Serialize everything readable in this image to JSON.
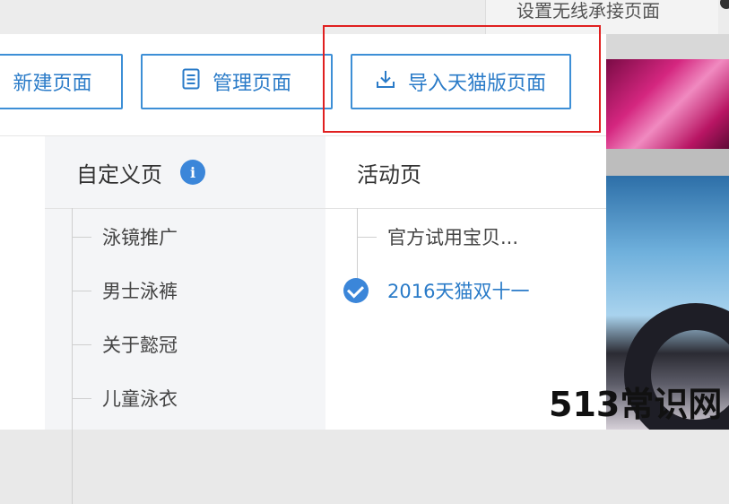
{
  "topbar": {
    "wireless_button_label": "设置无线承接页面"
  },
  "actions": {
    "new_label": "新建页面",
    "manage_label": "管理页面",
    "import_label": "导入天猫版页面"
  },
  "custom_pages": {
    "title": "自定义页",
    "info_icon_glyph": "i",
    "items": [
      {
        "label": "泳镜推广"
      },
      {
        "label": "男士泳裤"
      },
      {
        "label": "关于懿冠"
      },
      {
        "label": "儿童泳衣"
      }
    ]
  },
  "activity_pages": {
    "title": "活动页",
    "items": [
      {
        "label": "官方试用宝贝...",
        "selected": false
      },
      {
        "label": "2016天猫双十一",
        "selected": true
      }
    ]
  },
  "watermark": "513常识网",
  "colors": {
    "accent": "#2a7bc8",
    "highlight": "#e02020"
  }
}
